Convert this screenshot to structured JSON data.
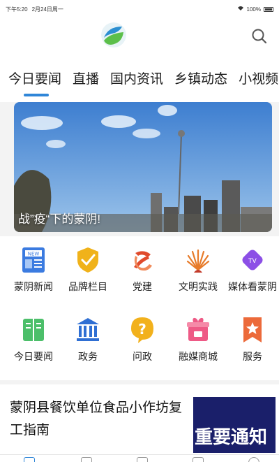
{
  "status_bar": {
    "time": "下午5:20",
    "date": "2月24日周一",
    "battery": "100%"
  },
  "header": {
    "logo": "app-logo-leaf",
    "search_icon": "search-icon"
  },
  "tabs": [
    {
      "label": "今日要闻",
      "active": true
    },
    {
      "label": "直播",
      "active": false
    },
    {
      "label": "国内资讯",
      "active": false
    },
    {
      "label": "乡镇动态",
      "active": false
    },
    {
      "label": "小视频",
      "active": false
    }
  ],
  "banner": {
    "caption": "战”疫“下的蒙阴!"
  },
  "grid": [
    {
      "label": "蒙阴新闻",
      "icon": "newspaper-icon",
      "color": "#3b7be0"
    },
    {
      "label": "品牌栏目",
      "icon": "shield-check-icon",
      "color": "#f0b21a"
    },
    {
      "label": "党建",
      "icon": "party-emblem-icon",
      "color": "#e04a2c"
    },
    {
      "label": "文明实践",
      "icon": "sunburst-icon",
      "color": "#e77b2a"
    },
    {
      "label": "媒体看蒙阴",
      "icon": "tv-badge-icon",
      "color": "#8c4fe6"
    },
    {
      "label": "今日要闻",
      "icon": "book-icon",
      "color": "#4cbf6a"
    },
    {
      "label": "政务",
      "icon": "government-building-icon",
      "color": "#2f6fd3"
    },
    {
      "label": "问政",
      "icon": "question-bubble-icon",
      "color": "#f2b11c"
    },
    {
      "label": "融媒商城",
      "icon": "gift-box-icon",
      "color": "#ee5a86"
    },
    {
      "label": "服务",
      "icon": "bookmark-star-icon",
      "color": "#ec6a3a"
    }
  ],
  "news": {
    "title": "蒙阴县餐饮单位食品小作坊复工指南",
    "thumb_text": "重要通知"
  },
  "accent_color": "#2f86d8"
}
